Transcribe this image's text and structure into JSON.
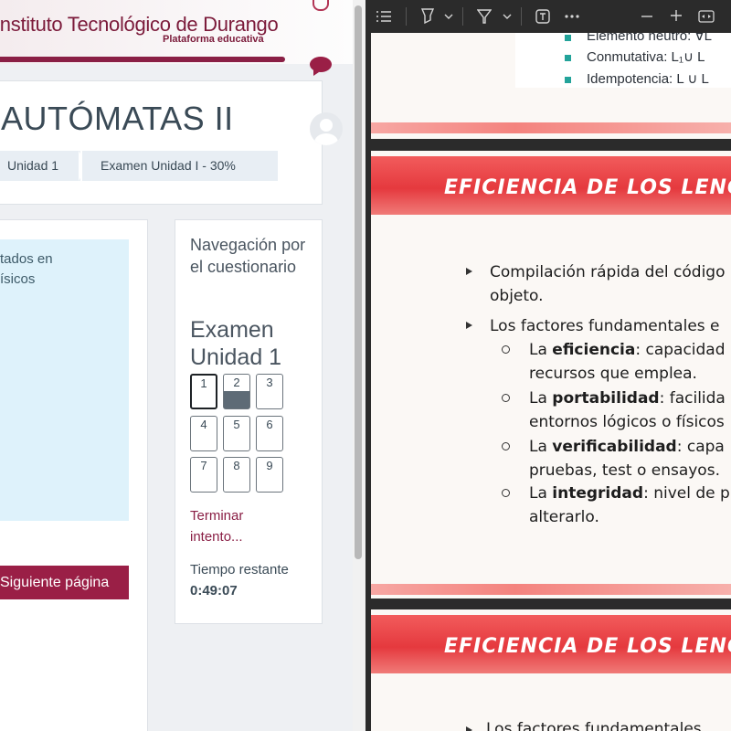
{
  "header": {
    "institute": "Instituto Tecnológico de Durango",
    "platform": "Plataforma educativa"
  },
  "course": {
    "title": "AUTÓMATAS II"
  },
  "breadcrumb": [
    "Unidad 1",
    "Examen Unidad I - 30%"
  ],
  "question_info": {
    "line1": "tados en",
    "line2": "ísicos"
  },
  "next_button": "Siguiente página",
  "quiz_nav": {
    "title": "Navegación por el cuestionario",
    "quiz_name": "Examen Unidad 1",
    "questions": [
      "1",
      "2",
      "3",
      "4",
      "5",
      "6",
      "7",
      "8",
      "9"
    ],
    "current": "1",
    "answered": [
      "2"
    ],
    "finish_link": "Terminar intento...",
    "time_label": "Tiempo restante",
    "time_value": "0:49:07"
  },
  "viewer": {
    "toolbar_icons": [
      "list-icon",
      "highlighter-icon",
      "chevron-down-icon",
      "filter-draw-icon",
      "chevron-down-icon",
      "text-box-icon",
      "more-icon",
      "zoom-out-icon",
      "zoom-in-icon",
      "fit-page-icon"
    ],
    "slide0": {
      "items": [
        "Elemento neutro: ∀L",
        "Conmutativa: L₁∪ L",
        "Idempotencia: L ∪ L"
      ]
    },
    "slide1": {
      "title": "EFICIENCIA DE LOS LENGUAJES",
      "bullet1_l1": "Compilación rápida del código",
      "bullet1_l2": "objeto.",
      "bullet2": "Los factores fundamentales e",
      "sub1_pre": "La ",
      "sub1_bold": "eficiencia",
      "sub1_post": ": capacidad",
      "sub1_l2": "recursos que emplea.",
      "sub2_pre": "La ",
      "sub2_bold": "portabilidad",
      "sub2_post": ": facilida",
      "sub2_l2": "entornos lógicos o físicos",
      "sub3_pre": "La ",
      "sub3_bold": "verificabilidad",
      "sub3_post": ": capa",
      "sub3_l2": "pruebas, test o ensayos.",
      "sub4_pre": "La ",
      "sub4_bold": "integridad",
      "sub4_post": ": nivel de p",
      "sub4_l2": "alterarlo."
    },
    "slide2": {
      "title": "EFICIENCIA DE LOS LENGUAJES",
      "bullet": "Los factores fundamentales"
    }
  },
  "colors": {
    "brand": "#8a1f45",
    "accent_teal": "#23a39a",
    "slide_red": "#e5393e"
  }
}
